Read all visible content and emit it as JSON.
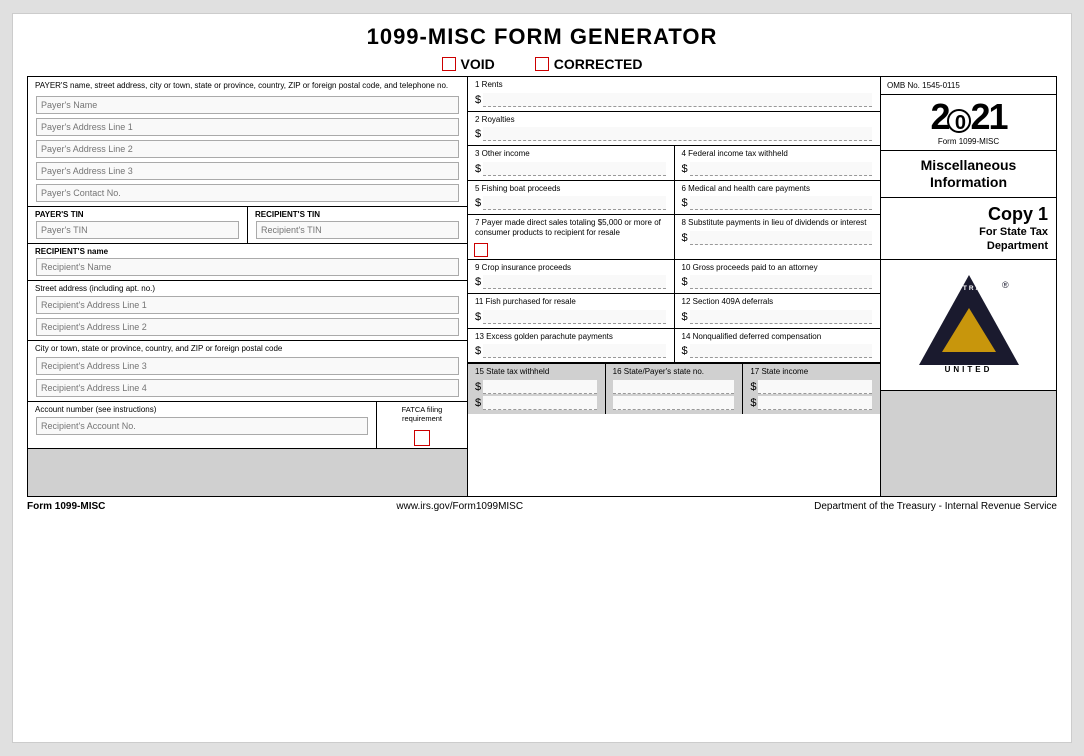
{
  "title": "1099-MISC FORM GENERATOR",
  "void_label": "VOID",
  "corrected_label": "CORRECTED",
  "payer_section": {
    "description": "PAYER'S name, street address, city or town, state or province, country, ZIP or foreign postal code, and telephone no.",
    "name_placeholder": "Payer's Name",
    "address1_placeholder": "Payer's Address Line 1",
    "address2_placeholder": "Payer's Address Line 2",
    "address3_placeholder": "Payer's Address Line 3",
    "contact_placeholder": "Payer's Contact No."
  },
  "payer_tin_label": "PAYER'S TIN",
  "payer_tin_placeholder": "Payer's TIN",
  "recipient_tin_label": "RECIPIENT'S TIN",
  "recipient_tin_placeholder": "Recipient's TIN",
  "recipient_name_label": "RECIPIENT'S name",
  "recipient_name_placeholder": "Recipient's Name",
  "street_label": "Street address (including apt. no.)",
  "street1_placeholder": "Recipient's Address Line 1",
  "street2_placeholder": "Recipient's Address Line 2",
  "city_label": "City or town, state or province, country, and ZIP or foreign postal code",
  "city1_placeholder": "Recipient's Address Line 3",
  "city2_placeholder": "Recipient's Address Line 4",
  "account_label": "Account number (see instructions)",
  "account_placeholder": "Recipient's Account No.",
  "fatca_label": "FATCA filing requirement",
  "fields": {
    "f1_label": "1 Rents",
    "f2_label": "2 Royalties",
    "f3_label": "3 Other income",
    "f4_label": "4 Federal income tax withheld",
    "f5_label": "5 Fishing boat proceeds",
    "f6_label": "6 Medical and health care payments",
    "f7_label": "7 Payer made direct sales totaling $5,000 or more of consumer products to recipient for resale",
    "f8_label": "8 Substitute payments in lieu of dividends or interest",
    "f9_label": "9 Crop insurance proceeds",
    "f10_label": "10 Gross proceeds paid to an attorney",
    "f11_label": "11 Fish purchased for resale",
    "f12_label": "12 Section 409A deferrals",
    "f13_label": "13 Excess golden parachute payments",
    "f14_label": "14 Nonqualified deferred compensation",
    "f15_label": "15 State tax withheld",
    "f16_label": "16 State/Payer's state no.",
    "f17_label": "17 State income"
  },
  "omb": "OMB No. 1545-0115",
  "year": "2021",
  "year_circle_char": "0",
  "form_name": "Form 1099-MISC",
  "misc_info_line1": "Miscellaneous",
  "misc_info_line2": "Information",
  "copy_title": "Copy 1",
  "copy_subtitle_line1": "For State Tax",
  "copy_subtitle_line2": "Department",
  "logo_abstract": "ABSTRACT",
  "logo_united": "UNITED",
  "footer_left_prefix": "Form ",
  "footer_left_bold": "1099-MISC",
  "footer_center": "www.irs.gov/Form1099MISC",
  "footer_right": "Department of the Treasury - Internal Revenue Service"
}
